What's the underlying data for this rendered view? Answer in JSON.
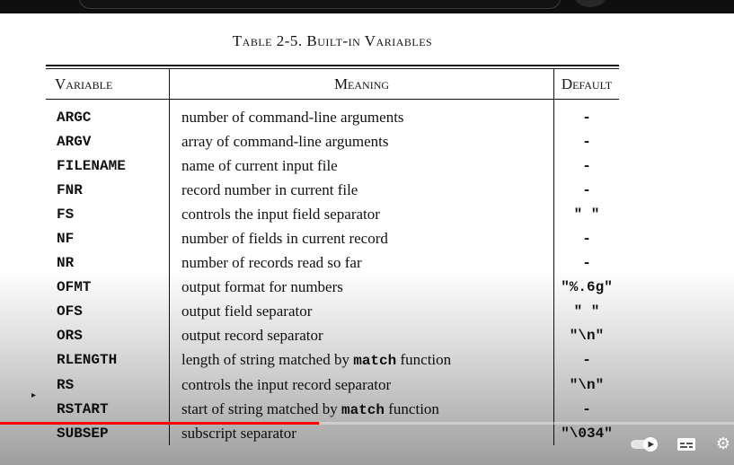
{
  "caption": "Table 2-5. Built-in Variables",
  "table": {
    "headers": {
      "variable": "Variable",
      "meaning": "Meaning",
      "default": "Default"
    },
    "rows": [
      {
        "variable": "ARGC",
        "meaning": "number of command-line arguments",
        "default": "-"
      },
      {
        "variable": "ARGV",
        "meaning": "array of command-line arguments",
        "default": "-"
      },
      {
        "variable": "FILENAME",
        "meaning": "name of current input file",
        "default": "-"
      },
      {
        "variable": "FNR",
        "meaning": "record number in current file",
        "default": "-"
      },
      {
        "variable": "FS",
        "meaning": "controls the input field separator",
        "default": "\" \""
      },
      {
        "variable": "NF",
        "meaning": "number of fields in current record",
        "default": "-"
      },
      {
        "variable": "NR",
        "meaning": "number of records read so far",
        "default": "-"
      },
      {
        "variable": "OFMT",
        "meaning": "output format for numbers",
        "default": "\"%.6g\""
      },
      {
        "variable": "OFS",
        "meaning": "output field separator",
        "default": "\" \""
      },
      {
        "variable": "ORS",
        "meaning": "output record separator",
        "default": "\"\\n\""
      },
      {
        "variable": "RLENGTH",
        "meaning_pre": "length of string matched by ",
        "meaning_code": "match",
        "meaning_post": " function",
        "default": "-"
      },
      {
        "variable": "RS",
        "meaning": "controls the input record separator",
        "default": "\"\\n\""
      },
      {
        "variable": "RSTART",
        "meaning_pre": "start of string matched by ",
        "meaning_code": "match",
        "meaning_post": " function",
        "default": "-"
      },
      {
        "variable": "SUBSEP",
        "meaning": "subscript separator",
        "default": "\"\\034\""
      }
    ]
  },
  "player": {
    "progress": 0.435,
    "icons": {
      "autoplay": "autoplay-toggle-icon",
      "subtitles": "subtitles-icon",
      "settings": "gear-icon"
    },
    "accent": "#ff0000"
  }
}
